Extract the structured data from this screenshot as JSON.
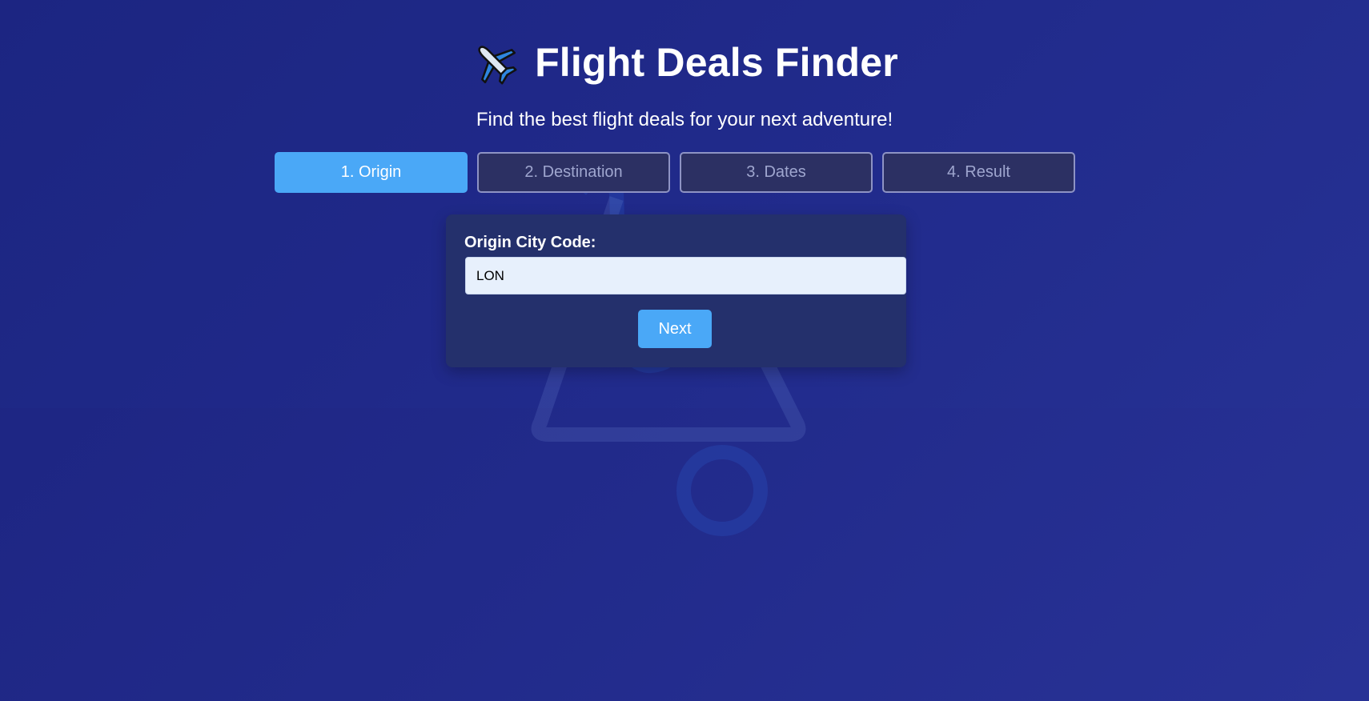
{
  "header": {
    "title": "Flight Deals Finder",
    "subtitle": "Find the best flight deals for your next adventure!",
    "logo_icon": "airplane-icon"
  },
  "steps": [
    {
      "label": "1. Origin",
      "active": true
    },
    {
      "label": "2. Destination",
      "active": false
    },
    {
      "label": "3. Dates",
      "active": false
    },
    {
      "label": "4. Result",
      "active": false
    }
  ],
  "form": {
    "label": "Origin City Code:",
    "value": "LON",
    "next_label": "Next"
  },
  "colors": {
    "accent": "#4aa8f7",
    "background": "#1c237f",
    "card": "#24306c"
  }
}
